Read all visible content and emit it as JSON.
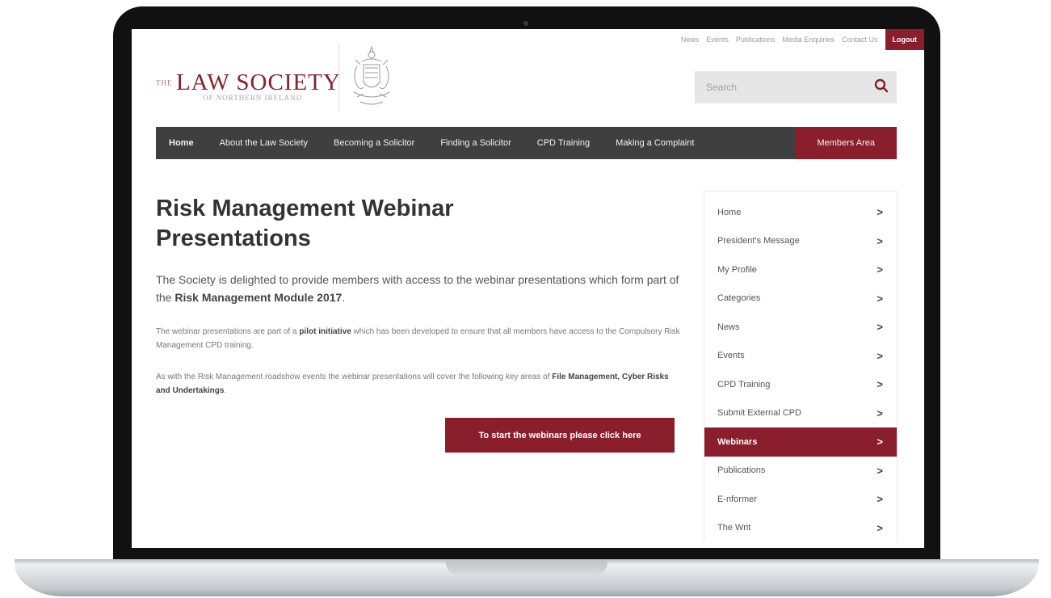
{
  "utility": {
    "links": [
      "News",
      "Events",
      "Publications",
      "Media Enquiries",
      "Contact Us"
    ],
    "logout": "Logout"
  },
  "logo": {
    "the": "THE",
    "main": "LAW SOCIETY",
    "sub": "OF NORTHERN IRELAND"
  },
  "search": {
    "placeholder": "Search"
  },
  "nav": {
    "items": [
      "Home",
      "About the Law Society",
      "Becoming a Solicitor",
      "Finding a Solicitor",
      "CPD Training",
      "Making a Complaint"
    ],
    "members": "Members Area"
  },
  "main": {
    "title": "Risk Management Webinar Presentations",
    "intro_pre": "The Society is delighted to provide members with access to the webinar presentations which form part of the ",
    "intro_bold": "Risk Management Module 2017",
    "intro_post": ".",
    "p2_pre": "The webinar presentations are part of a ",
    "p2_bold": "pilot initiative",
    "p2_post": " which has been developed to ensure that all members have access to the Compulsory Risk Management CPD training.",
    "p3_pre": "As with the Risk Management roadshow events the webinar presentations will cover the following key areas of ",
    "p3_bold": "File Management, Cyber Risks and Undertakings",
    "p3_post": ".",
    "cta": "To start the webinars please click here"
  },
  "sidebar": {
    "items": [
      {
        "label": "Home"
      },
      {
        "label": "President's Message"
      },
      {
        "label": "My Profile"
      },
      {
        "label": "Categories"
      },
      {
        "label": "News"
      },
      {
        "label": "Events"
      },
      {
        "label": "CPD Training"
      },
      {
        "label": "Submit External CPD"
      },
      {
        "label": "Webinars"
      },
      {
        "label": "Publications"
      },
      {
        "label": "E-nformer"
      },
      {
        "label": "The Writ"
      }
    ],
    "active_index": 8,
    "chevron": ">"
  },
  "colors": {
    "brand": "#8a1e2c",
    "nav_bg": "#3f3f3f"
  }
}
